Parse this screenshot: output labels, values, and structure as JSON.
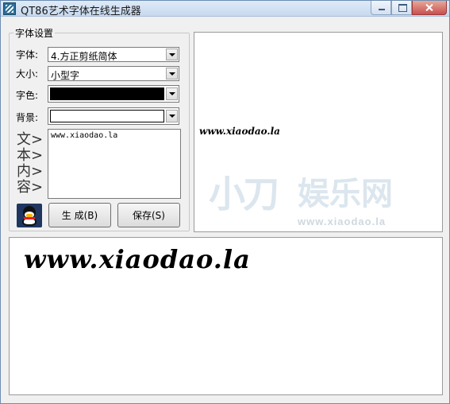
{
  "window": {
    "title": "QT86艺术字体在线生成器"
  },
  "settings": {
    "group_label": "字体设置",
    "font_label": "字体:",
    "font_value": "4.方正剪纸简体",
    "size_label": "大小:",
    "size_value": "小型字",
    "color_label": "字色:",
    "color_value": "#000000",
    "bg_label": "背景:",
    "bg_value": "#ffffff",
    "text_label_chars": [
      "文>",
      "本>",
      "内>",
      "容>"
    ],
    "text_value": "www.xiaodao.la"
  },
  "buttons": {
    "generate": "生 成(B)",
    "save": "保存(S)"
  },
  "preview": {
    "small_text": "www.xiaodao.la",
    "large_text": "www.xiaodao.la"
  },
  "watermark": {
    "url": "www.xiaodao.la",
    "brand_shape": "小刀",
    "brand_cn": "娱乐网"
  }
}
